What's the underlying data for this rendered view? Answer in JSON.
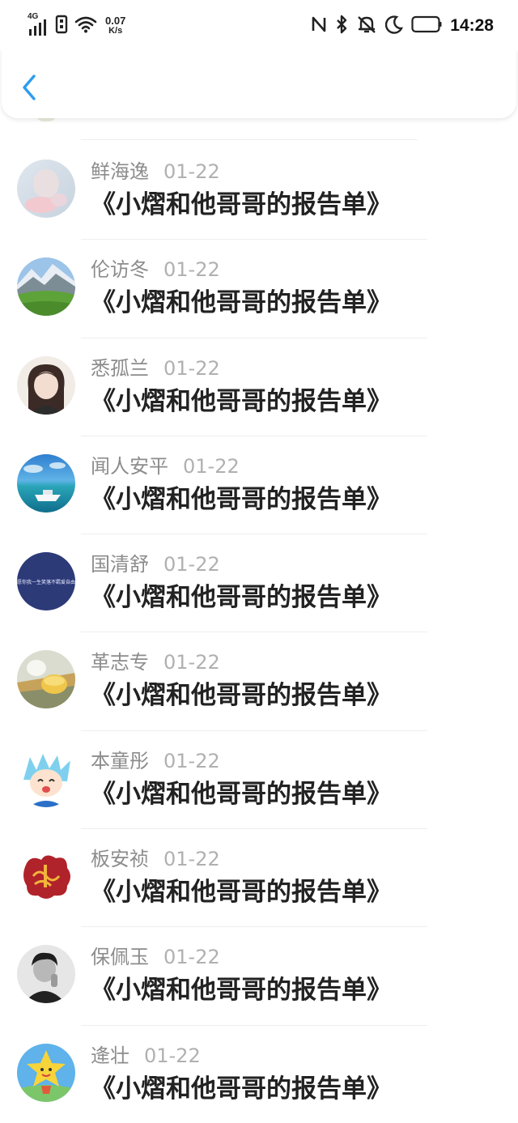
{
  "status_bar": {
    "network": "4G",
    "speed_value": "0.07",
    "speed_unit": "K/s",
    "time": "14:28",
    "icons": [
      "signal-icon",
      "sim-icon",
      "wifi-icon",
      "nfc-icon",
      "bluetooth-icon",
      "mute-bell-icon",
      "moon-icon",
      "battery-icon"
    ]
  },
  "header": {
    "back_icon": "chevron-left-icon",
    "accent_color": "#2d9cf0"
  },
  "list": {
    "items": [
      {
        "name": "鲜海逸",
        "date": "01-22",
        "title": "《小熠和他哥哥的报告单》",
        "avatar": "pale-pastel-photo"
      },
      {
        "name": "伦访冬",
        "date": "01-22",
        "title": "《小熠和他哥哥的报告单》",
        "avatar": "mountain-meadow-photo"
      },
      {
        "name": "悉孤兰",
        "date": "01-22",
        "title": "《小熠和他哥哥的报告单》",
        "avatar": "anime-portrait"
      },
      {
        "name": "闻人安平",
        "date": "01-22",
        "title": "《小熠和他哥哥的报告单》",
        "avatar": "sea-boat-photo"
      },
      {
        "name": "国清舒",
        "date": "01-22",
        "title": "《小熠和他哥哥的报告单》",
        "avatar": "navy-text-circle",
        "avatar_text": "愿你我一生笑落不羁爱自由"
      },
      {
        "name": "革志专",
        "date": "01-22",
        "title": "《小熠和他哥哥的报告单》",
        "avatar": "tea-cup-photo"
      },
      {
        "name": "本童彤",
        "date": "01-22",
        "title": "《小熠和他哥哥的报告单》",
        "avatar": "cartoon-boy"
      },
      {
        "name": "板安祯",
        "date": "01-22",
        "title": "《小熠和他哥哥的报告单》",
        "avatar": "red-fu-character"
      },
      {
        "name": "保佩玉",
        "date": "01-22",
        "title": "《小熠和他哥哥的报告单》",
        "avatar": "bw-portrait"
      },
      {
        "name": "逄壮",
        "date": "01-22",
        "title": "《小熠和他哥哥的报告单》",
        "avatar": "yellow-star-cartoon"
      }
    ]
  }
}
